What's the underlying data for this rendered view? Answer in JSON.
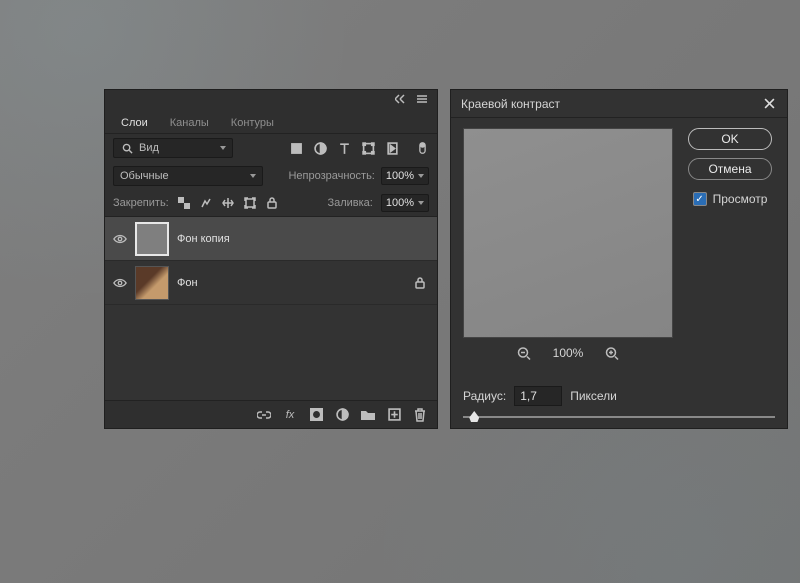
{
  "layers_panel": {
    "tabs": [
      "Слои",
      "Каналы",
      "Контуры"
    ],
    "active_tab": 0,
    "search_label": "Вид",
    "blend_mode": "Обычные",
    "opacity_label": "Непрозрачность:",
    "opacity_value": "100%",
    "lock_label": "Закрепить:",
    "fill_label": "Заливка:",
    "fill_value": "100%",
    "layer_items": [
      {
        "name": "Фон копия",
        "selected": true,
        "locked": false,
        "thumb": "gray"
      },
      {
        "name": "Фон",
        "selected": false,
        "locked": true,
        "thumb": "img"
      }
    ]
  },
  "filter_dialog": {
    "title": "Краевой контраст",
    "ok": "OK",
    "cancel": "Отмена",
    "preview_label": "Просмотр",
    "zoom_text": "100%",
    "radius_label": "Радиус:",
    "radius_value": "1,7",
    "radius_unit": "Пиксели"
  }
}
